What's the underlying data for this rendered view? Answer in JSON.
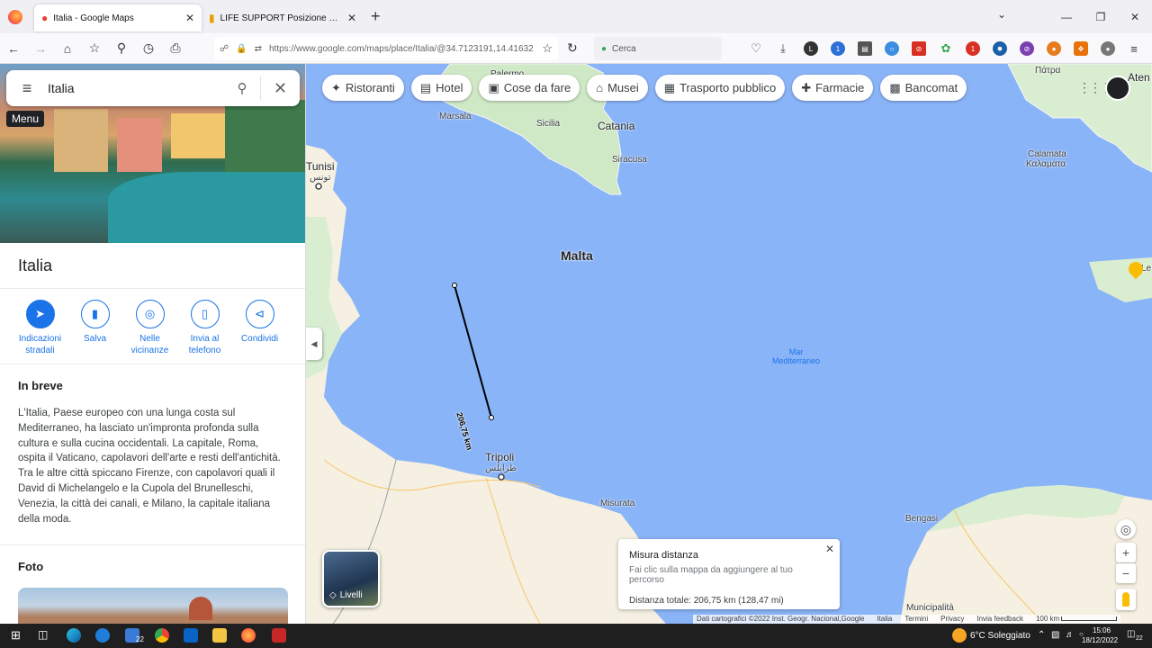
{
  "browser": {
    "tabs": [
      {
        "title": "Italia - Google Maps",
        "icon": "google-maps-icon",
        "active": true
      },
      {
        "title": "LIFE SUPPORT Posizione attuale (Search",
        "icon": "site-icon",
        "active": false
      }
    ],
    "url_domain": "https://www.google.com",
    "url_path": "/maps/place/Italia/@34.7123191,14.41632",
    "search_placeholder": "Cerca",
    "ext_badges": {
      "ext1": "1",
      "ext2": "1"
    }
  },
  "sidebar": {
    "search_value": "Italia",
    "menu_tooltip": "Menu",
    "place_title": "Italia",
    "actions": [
      {
        "label": "Indicazioni stradali",
        "icon": "directions-icon"
      },
      {
        "label": "Salva",
        "icon": "bookmark-icon"
      },
      {
        "label": "Nelle vicinanze",
        "icon": "nearby-icon"
      },
      {
        "label": "Invia al telefono",
        "icon": "send-to-phone-icon"
      },
      {
        "label": "Condividi",
        "icon": "share-icon"
      }
    ],
    "overview_title": "In breve",
    "overview_text": "L'Italia, Paese europeo con una lunga costa sul Mediterraneo, ha lasciato un'impronta profonda sulla cultura e sulla cucina occidentali. La capitale, Roma, ospita il Vaticano, capolavori dell'arte e resti dell'antichità. Tra le altre città spiccano Firenze, con capolavori quali il David di Michelangelo e la Cupola del Brunelleschi, Venezia, la città dei canali, e Milano, la capitale italiana della moda.",
    "photos_title": "Foto"
  },
  "map": {
    "chips": [
      {
        "label": "Ristoranti",
        "icon": "restaurant-icon"
      },
      {
        "label": "Hotel",
        "icon": "hotel-icon"
      },
      {
        "label": "Cose da fare",
        "icon": "camera-icon"
      },
      {
        "label": "Musei",
        "icon": "museum-icon"
      },
      {
        "label": "Trasporto pubblico",
        "icon": "transit-icon"
      },
      {
        "label": "Farmacie",
        "icon": "pharmacy-icon"
      },
      {
        "label": "Bancomat",
        "icon": "atm-icon"
      }
    ],
    "labels": {
      "palermo": "Palermo",
      "marsala": "Marsala",
      "sicilia": "Sicilia",
      "catania": "Catania",
      "siracusa": "Siracusa",
      "tunisi": "Tunisi",
      "tunisi_ar": "تونس",
      "malta": "Malta",
      "mar1": "Mar",
      "mar2": "Mediterraneo",
      "tripoli": "Tripoli",
      "tripoli_ar": "طرابلس",
      "misurata": "Misurata",
      "bengasi": "Bengasi",
      "municipalita": "Municipalità",
      "patra": "Πάτρα",
      "atene": "Aten",
      "calamata": "Calamata",
      "calamata_gr": "Καλαμάτα",
      "le": "Le"
    },
    "measure_line_label": "206,75 km",
    "layers_label": "Livelli",
    "measure": {
      "title": "Misura distanza",
      "hint": "Fai clic sulla mappa da aggiungere al tuo percorso",
      "total": "Distanza totale: 206,75 km (128,47 mi)"
    },
    "footer": [
      "Dati cartografici ©2022 Inst. Geogr. Nacional,Google",
      "Italia",
      "Termini",
      "Privacy",
      "Invia feedback",
      "100 km"
    ]
  },
  "taskbar": {
    "badge1": "22",
    "weather": "6°C  Soleggiato",
    "time": "15:06",
    "date": "18/12/2022",
    "notif": "22"
  }
}
